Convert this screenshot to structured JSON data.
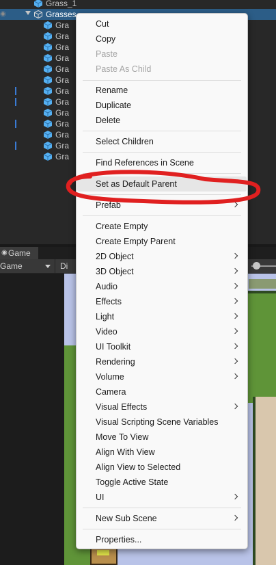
{
  "hierarchy": {
    "items": [
      {
        "label": "Grass_1"
      },
      {
        "label": "Grasses"
      },
      {
        "label": "Gra"
      },
      {
        "label": "Gra"
      },
      {
        "label": "Gra"
      },
      {
        "label": "Gra"
      },
      {
        "label": "Gra"
      },
      {
        "label": "Gra"
      },
      {
        "label": "Gra"
      },
      {
        "label": "Gra"
      },
      {
        "label": "Gra"
      },
      {
        "label": "Gra"
      },
      {
        "label": "Gra"
      },
      {
        "label": "Gra"
      },
      {
        "label": "Gra"
      }
    ]
  },
  "game": {
    "tab_label": "Game",
    "display_value": "Game",
    "second_dropdown": "Di"
  },
  "menu": {
    "items": [
      {
        "label": "Cut"
      },
      {
        "label": "Copy"
      },
      {
        "label": "Paste"
      },
      {
        "label": "Paste As Child"
      },
      {
        "label": "Rename"
      },
      {
        "label": "Duplicate"
      },
      {
        "label": "Delete"
      },
      {
        "label": "Select Children"
      },
      {
        "label": "Find References in Scene"
      },
      {
        "label": "Set as Default Parent"
      },
      {
        "label": "Prefab"
      },
      {
        "label": "Create Empty"
      },
      {
        "label": "Create Empty Parent"
      },
      {
        "label": "2D Object"
      },
      {
        "label": "3D Object"
      },
      {
        "label": "Audio"
      },
      {
        "label": "Effects"
      },
      {
        "label": "Light"
      },
      {
        "label": "Video"
      },
      {
        "label": "UI Toolkit"
      },
      {
        "label": "Rendering"
      },
      {
        "label": "Volume"
      },
      {
        "label": "Camera"
      },
      {
        "label": "Visual Effects"
      },
      {
        "label": "Visual Scripting Scene Variables"
      },
      {
        "label": "Move To View"
      },
      {
        "label": "Align With View"
      },
      {
        "label": "Align View to Selected"
      },
      {
        "label": "Toggle Active State"
      },
      {
        "label": "UI"
      },
      {
        "label": "New Sub Scene"
      },
      {
        "label": "Properties..."
      }
    ]
  },
  "colors": {
    "selection": "#2c5d87",
    "cube_icon": "#55b0f2",
    "annotation": "#e02020"
  }
}
